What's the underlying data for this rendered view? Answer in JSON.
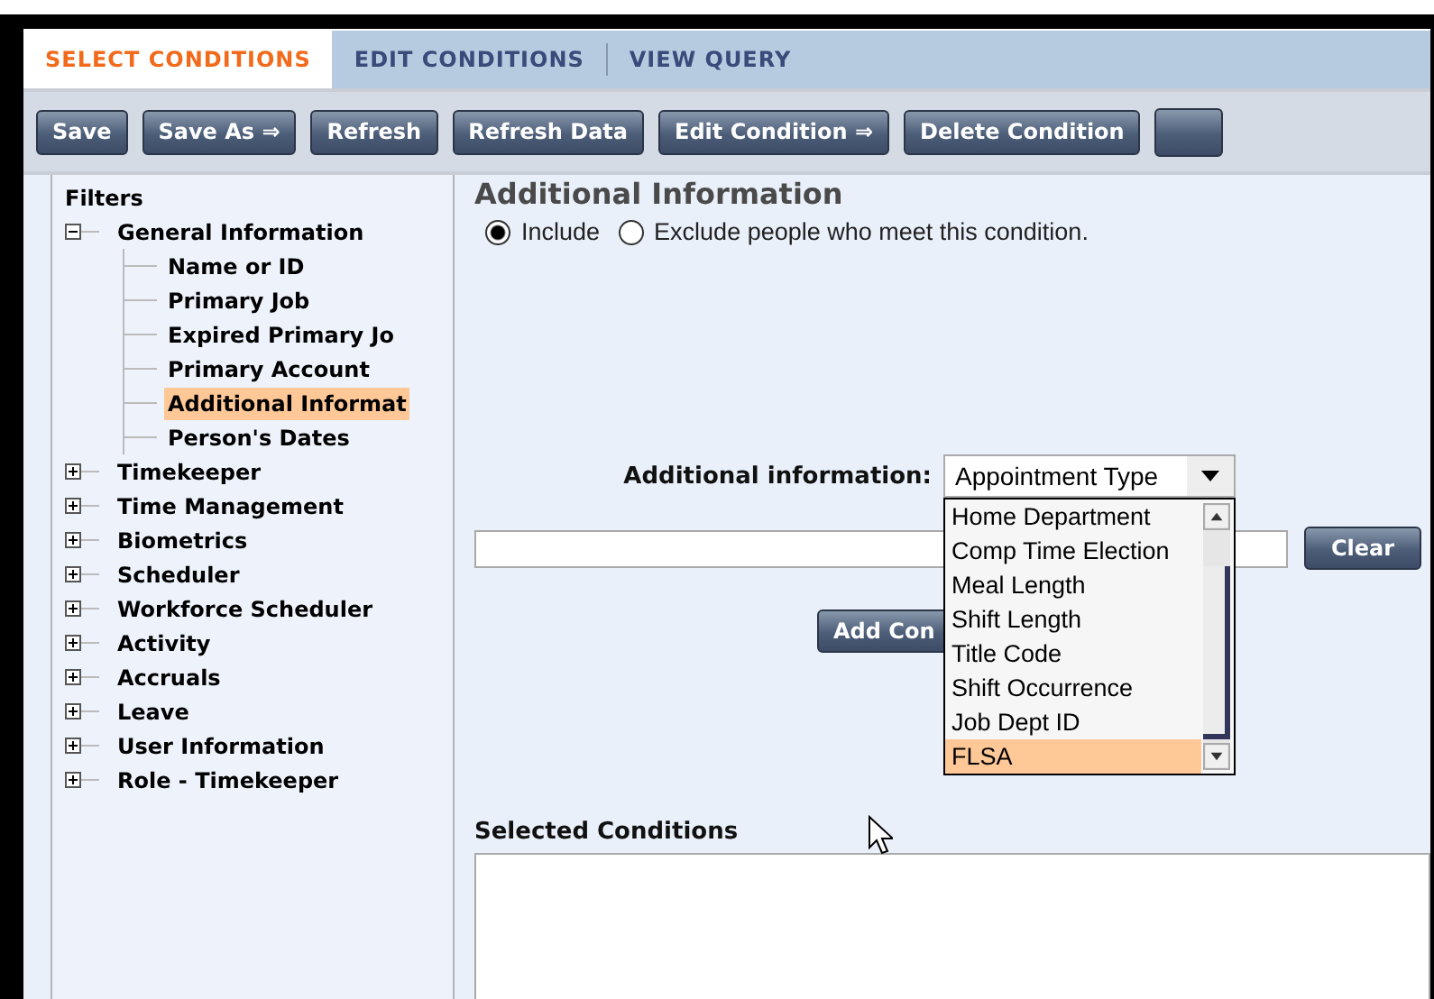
{
  "tabs": [
    {
      "label": "SELECT CONDITIONS",
      "selected": true
    },
    {
      "label": "EDIT CONDITIONS",
      "selected": false
    },
    {
      "label": "VIEW QUERY",
      "selected": false
    }
  ],
  "toolbar": [
    {
      "label": "Save"
    },
    {
      "label": "Save As ⇒"
    },
    {
      "label": "Refresh"
    },
    {
      "label": "Refresh Data"
    },
    {
      "label": "Edit Condition ⇒"
    },
    {
      "label": "Delete Condition"
    }
  ],
  "filters": {
    "title": "Filters",
    "items": [
      {
        "label": "General Information",
        "expanded": true,
        "selected": false,
        "children": [
          {
            "label": "Name or ID",
            "selected": false
          },
          {
            "label": "Primary Job",
            "selected": false
          },
          {
            "label": "Expired Primary Jo",
            "selected": false
          },
          {
            "label": "Primary Account",
            "selected": false
          },
          {
            "label": "Additional Informat",
            "selected": true
          },
          {
            "label": "Person's Dates",
            "selected": false
          }
        ]
      },
      {
        "label": "Timekeeper",
        "expanded": false,
        "selected": false
      },
      {
        "label": "Time Management",
        "expanded": false,
        "selected": false
      },
      {
        "label": "Biometrics",
        "expanded": false,
        "selected": false
      },
      {
        "label": "Scheduler",
        "expanded": false,
        "selected": false
      },
      {
        "label": "Workforce Scheduler",
        "expanded": false,
        "selected": false
      },
      {
        "label": "Activity",
        "expanded": false,
        "selected": false
      },
      {
        "label": "Accruals",
        "expanded": false,
        "selected": false
      },
      {
        "label": "Leave",
        "expanded": false,
        "selected": false
      },
      {
        "label": "User Information",
        "expanded": false,
        "selected": false
      },
      {
        "label": "Role - Timekeeper",
        "expanded": false,
        "selected": false
      }
    ]
  },
  "content": {
    "heading": "Additional Information",
    "radios": [
      {
        "label": "Include",
        "selected": true
      },
      {
        "label": "Exclude people who meet this condition.",
        "selected": false
      }
    ],
    "dropdown": {
      "label": "Additional information:",
      "value": "Appointment Type",
      "open": true,
      "options": [
        {
          "label": "Home Department",
          "selected": false
        },
        {
          "label": "Comp Time Election",
          "selected": false
        },
        {
          "label": "Meal Length",
          "selected": false
        },
        {
          "label": "Shift Length",
          "selected": false
        },
        {
          "label": "Title Code",
          "selected": false
        },
        {
          "label": "Shift Occurrence",
          "selected": false
        },
        {
          "label": "Job Dept ID",
          "selected": false
        },
        {
          "label": "FLSA",
          "selected": true
        }
      ]
    },
    "clear_button": "Clear",
    "add_button": "Add Con",
    "selected_conditions": {
      "label": "Selected Conditions"
    }
  }
}
